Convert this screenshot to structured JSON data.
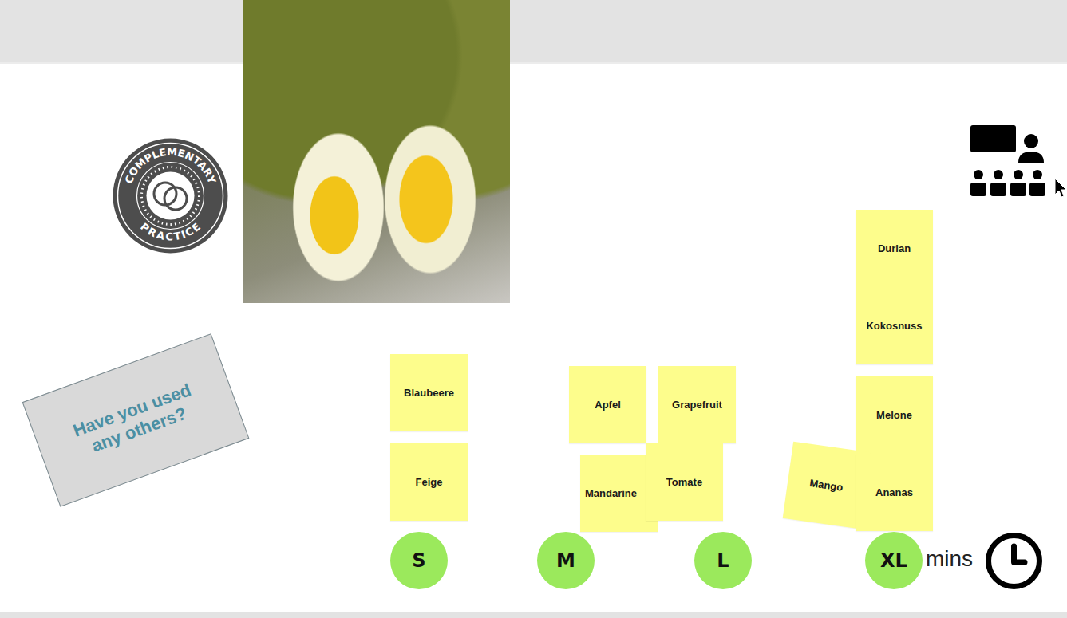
{
  "logo": {
    "top": "COMPLEMENTARY",
    "bottom": "PRACTICE"
  },
  "prompt_card": {
    "lines": [
      "Have you used",
      "any others?"
    ]
  },
  "notes": [
    {
      "text": "Blaubeere"
    },
    {
      "text": "Feige"
    },
    {
      "text": "Apfel"
    },
    {
      "text": "Grapefruit"
    },
    {
      "text": "Mandarine"
    },
    {
      "text": "Tomate"
    },
    {
      "text": "Durian"
    },
    {
      "text": "Kokosnuss"
    },
    {
      "text": "Melone"
    },
    {
      "text": "Mango"
    },
    {
      "text": "Ananas"
    }
  ],
  "size_markers": [
    {
      "label": "S"
    },
    {
      "label": "M"
    },
    {
      "label": "L"
    },
    {
      "label": "XL"
    }
  ],
  "timer": {
    "text": "mins"
  }
}
